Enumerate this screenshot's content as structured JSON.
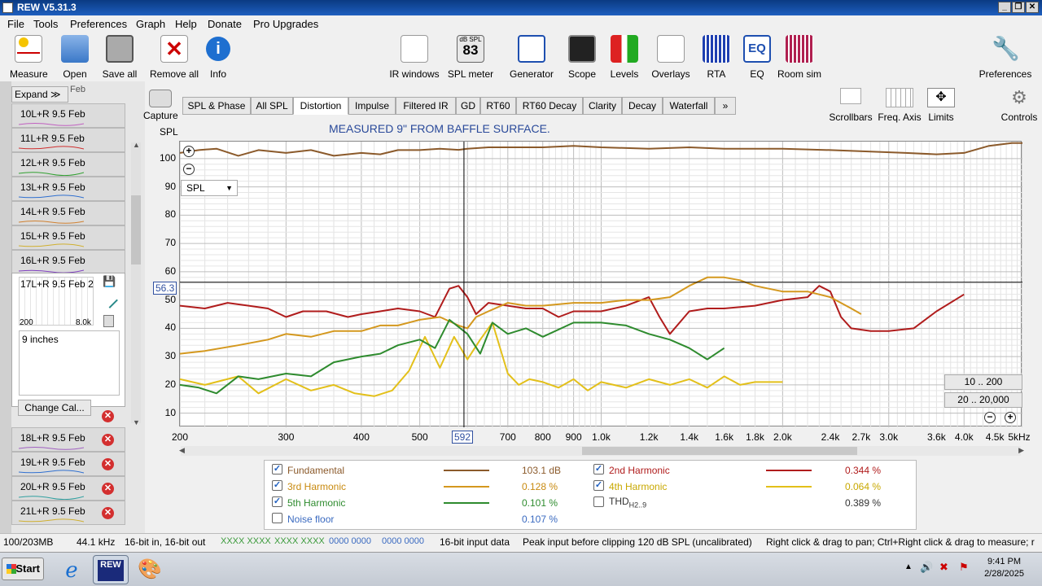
{
  "window": {
    "title": "REW V5.31.3"
  },
  "menu": [
    "File",
    "Tools",
    "Preferences",
    "Graph",
    "Help",
    "Donate",
    "Pro Upgrades"
  ],
  "toolbar": {
    "measure": "Measure",
    "open": "Open",
    "save_all": "Save all",
    "remove_all": "Remove all",
    "info": "Info",
    "ir_windows": "IR windows",
    "spl_meter": "SPL meter",
    "spl_meter_value": "83",
    "spl_meter_unit": "dB SPL",
    "generator": "Generator",
    "scope": "Scope",
    "levels": "Levels",
    "overlays": "Overlays",
    "rta": "RTA",
    "eq": "EQ",
    "eq_icon_text": "EQ",
    "room_sim": "Room sim",
    "preferences": "Preferences"
  },
  "sidebar": {
    "expand": "Expand",
    "expand_partial": "Feb",
    "rows": [
      {
        "num": "10",
        "name": "L+R 9.5 Feb"
      },
      {
        "num": "11",
        "name": "L+R 9.5 Feb"
      },
      {
        "num": "12",
        "name": "L+R 9.5 Feb"
      },
      {
        "num": "13",
        "name": "L+R 9.5 Feb"
      },
      {
        "num": "14",
        "name": "L+R 9.5 Feb"
      },
      {
        "num": "15",
        "name": "L+R 9.5 Feb"
      },
      {
        "num": "16",
        "name": "L+R 9.5 Feb"
      }
    ],
    "selected": {
      "num": "17",
      "name": "L+R 9.5 Feb 2",
      "mini_left": "200",
      "mini_right": "8.0k",
      "notes": "9 inches",
      "change_cal": "Change Cal..."
    },
    "rows_bottom": [
      {
        "num": "18",
        "name": "L+R 9.5 Feb"
      },
      {
        "num": "19",
        "name": "L+R 9.5 Feb"
      },
      {
        "num": "20",
        "name": "L+R 9.5 Feb"
      },
      {
        "num": "21",
        "name": "L+R 9.5 Feb"
      }
    ]
  },
  "capture": "Capture",
  "tabs": [
    "SPL & Phase",
    "All SPL",
    "Distortion",
    "Impulse",
    "Filtered IR",
    "GD",
    "RT60",
    "RT60 Decay",
    "Clarity",
    "Decay",
    "Waterfall"
  ],
  "tabs_more": "»",
  "active_tab": "Distortion",
  "right_tools": {
    "scrollbars": "Scrollbars",
    "freq_axis": "Freq. Axis",
    "limits": "Limits",
    "controls": "Controls"
  },
  "graph": {
    "title": "MEASURED 9\" FROM BAFFLE SURFACE.",
    "ylabel": "SPL",
    "y_ticks": [
      "100",
      "90",
      "80",
      "70",
      "60",
      "50",
      "40",
      "30",
      "20",
      "10"
    ],
    "x_ticks": [
      "200",
      "300",
      "400",
      "500",
      "592",
      "700",
      "800",
      "900",
      "1.0k",
      "1.2k",
      "1.4k",
      "1.6k",
      "1.8k",
      "2.0k",
      "2.4k",
      "2.7k",
      "3.0k",
      "3.6k",
      "4.0k",
      "4.5k",
      "5kHz"
    ],
    "cursor_y": "56.3",
    "cursor_x": "592",
    "selector": "SPL",
    "range_btn1": "10 .. 200",
    "range_btn2": "20 .. 20,000"
  },
  "chart_data": {
    "type": "line",
    "title": "MEASURED 9\" FROM BAFFLE SURFACE.",
    "xlabel": "Hz",
    "ylabel": "SPL",
    "xscale": "log",
    "xlim": [
      200,
      5000
    ],
    "ylim": [
      5,
      106
    ],
    "grid": true,
    "series": [
      {
        "name": "Fundamental",
        "color": "#8b5a2b",
        "x": [
          200,
          215,
          230,
          250,
          270,
          300,
          330,
          360,
          400,
          430,
          460,
          500,
          540,
          580,
          600,
          650,
          700,
          800,
          900,
          1000,
          1200,
          1400,
          1600,
          1800,
          2000,
          2400,
          2800,
          3200,
          3600,
          4000,
          4400,
          4800,
          5000
        ],
        "y": [
          102,
          103,
          103.5,
          101,
          103,
          102,
          103,
          101,
          102,
          101.5,
          103,
          103,
          103.5,
          103.1,
          103.5,
          104,
          104,
          104,
          104.5,
          104,
          103.5,
          104,
          103.5,
          103.5,
          103.5,
          103,
          102.5,
          102,
          101.5,
          102,
          104.5,
          105.5,
          105.5
        ]
      },
      {
        "name": "2nd Harmonic",
        "color": "#b01c1c",
        "x": [
          200,
          220,
          240,
          260,
          280,
          300,
          320,
          350,
          380,
          400,
          430,
          460,
          500,
          530,
          560,
          580,
          600,
          620,
          650,
          700,
          750,
          800,
          850,
          900,
          1000,
          1100,
          1200,
          1250,
          1300,
          1400,
          1500,
          1600,
          1800,
          2000,
          2200,
          2300,
          2400,
          2500,
          2600,
          2800,
          3000,
          3300,
          3600,
          4000
        ],
        "y": [
          48,
          47,
          49,
          48,
          47,
          44,
          46,
          46,
          44,
          45,
          46,
          47,
          46,
          44,
          54,
          55,
          51,
          45,
          49,
          48,
          47,
          47,
          44,
          46,
          46,
          48,
          51,
          44,
          38,
          46,
          47,
          47,
          48,
          50,
          51,
          55,
          53,
          44,
          40,
          39,
          39,
          40,
          46,
          52
        ]
      },
      {
        "name": "3rd Harmonic",
        "color": "#d4981e",
        "x": [
          200,
          220,
          250,
          280,
          300,
          330,
          360,
          400,
          430,
          460,
          500,
          540,
          580,
          600,
          620,
          650,
          700,
          750,
          800,
          900,
          1000,
          1100,
          1200,
          1300,
          1400,
          1500,
          1600,
          1700,
          1800,
          2000,
          2200,
          2400,
          2600,
          2700
        ],
        "y": [
          31,
          32,
          34,
          36,
          38,
          37,
          39,
          39,
          41,
          41,
          43,
          44,
          41,
          40,
          44,
          46,
          49,
          48,
          48,
          49,
          49,
          50,
          50,
          51,
          55,
          58,
          58,
          57,
          55,
          53,
          53,
          51,
          47,
          45
        ]
      },
      {
        "name": "4th Harmonic",
        "color": "#e3c01a",
        "x": [
          200,
          220,
          250,
          270,
          300,
          330,
          360,
          390,
          420,
          450,
          480,
          510,
          540,
          570,
          600,
          630,
          660,
          700,
          730,
          760,
          800,
          850,
          900,
          950,
          1000,
          1100,
          1200,
          1300,
          1400,
          1500,
          1600,
          1700,
          1800,
          2000
        ],
        "y": [
          22,
          20,
          23,
          17,
          22,
          18,
          20,
          17,
          16,
          18,
          25,
          37,
          26,
          37,
          29,
          36,
          42,
          24,
          20,
          22,
          21,
          19,
          22,
          18,
          21,
          19,
          22,
          20,
          22,
          19,
          23,
          20,
          21,
          21
        ]
      },
      {
        "name": "5th Harmonic",
        "color": "#2e8b2e",
        "x": [
          200,
          215,
          230,
          250,
          270,
          300,
          330,
          360,
          400,
          430,
          460,
          500,
          530,
          560,
          600,
          630,
          660,
          700,
          750,
          800,
          900,
          1000,
          1100,
          1200,
          1300,
          1400,
          1500,
          1600
        ],
        "y": [
          20,
          19,
          17,
          23,
          22,
          24,
          23,
          28,
          30,
          31,
          34,
          36,
          33,
          43,
          38,
          31,
          42,
          38,
          40,
          37,
          42,
          42,
          41,
          38,
          36,
          33,
          29,
          33
        ]
      }
    ]
  },
  "legend": [
    {
      "name": "Fundamental",
      "value": "103.1 dB",
      "color": "#8b5a2b",
      "checked": true
    },
    {
      "name": "2nd Harmonic",
      "value": "0.344 %",
      "color": "#b01c1c",
      "checked": true
    },
    {
      "name": "3rd Harmonic",
      "value": "0.128 %",
      "color": "#d4981e",
      "checked": true
    },
    {
      "name": "4th Harmonic",
      "value": "0.064 %",
      "color": "#e3c01a",
      "checked": true
    },
    {
      "name": "5th Harmonic",
      "value": "0.101 %",
      "color": "#2e8b2e",
      "checked": true
    },
    {
      "name": "THD",
      "sub": "H2..9",
      "value": "0.389 %",
      "color": "",
      "checked": false
    },
    {
      "name": "Noise floor",
      "value": "0.107 %",
      "color": "",
      "checked": false
    }
  ],
  "status": {
    "memory": "100/203MB",
    "rate": "44.1 kHz",
    "bits": "16-bit in, 16-bit out",
    "io1": "XXXX XXXX",
    "io2": "XXXX XXXX",
    "io3": "0000 0000",
    "io4": "0000 0000",
    "input_data": "16-bit input data",
    "peak": "Peak input before clipping 120 dB SPL (uncalibrated)",
    "hint": "Right click & drag to pan; Ctrl+Right click & drag to measure; r"
  },
  "taskbar": {
    "start": "Start",
    "rew_label": "REW",
    "time": "9:41 PM",
    "date": "2/28/2025"
  }
}
